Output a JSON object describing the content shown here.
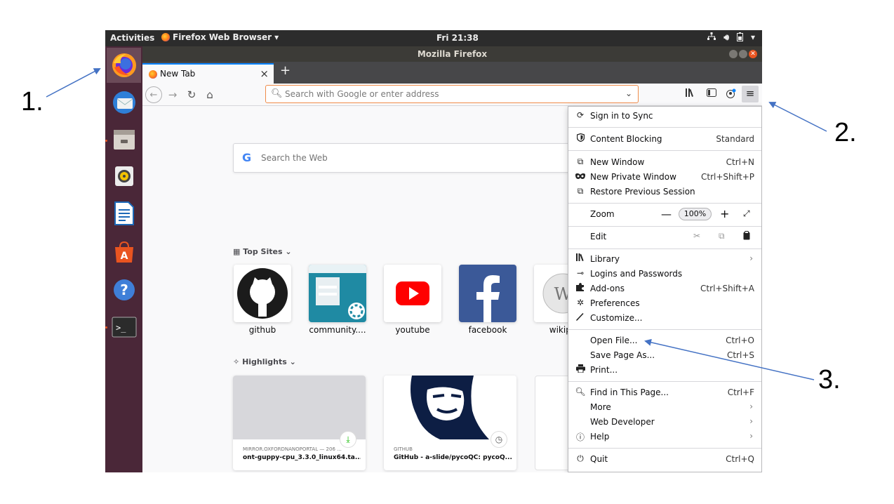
{
  "annotations": {
    "step1": "1.",
    "step2": "2.",
    "step3": "3.",
    "arrow_color": "#4472c4"
  },
  "top_panel": {
    "activities": "Activities",
    "app_menu": "Firefox Web Browser",
    "clock": "Fri 21:38",
    "tray_icons": [
      "network-icon",
      "volume-icon",
      "battery-icon",
      "power-menu-icon"
    ]
  },
  "launcher": {
    "background": "#4a2738",
    "apps": [
      "firefox-icon",
      "thunderbird-icon",
      "files-icon",
      "rhythmbox-icon",
      "libreoffice-writer-icon",
      "ubuntu-software-icon",
      "help-icon",
      "terminal-icon"
    ]
  },
  "window": {
    "title": "Mozilla Firefox"
  },
  "tab": {
    "label": "New Tab"
  },
  "urlbar": {
    "placeholder": "Search with Google or enter address"
  },
  "newtab": {
    "search_placeholder": "Search the Web",
    "top_sites_heading": "Top Sites",
    "top_sites": [
      {
        "label": "github"
      },
      {
        "label": "community...."
      },
      {
        "label": "youtube"
      },
      {
        "label": "facebook"
      },
      {
        "label": "wikipe"
      }
    ],
    "highlights_heading": "Highlights",
    "highlights": [
      {
        "source": "MIRROR.OXFORDNANOPORTAL — 206 ...",
        "title": "ont-guppy-cpu_3.3.0_linux64.ta..."
      },
      {
        "source": "GITHUB",
        "title": "GitHub - a-slide/pycoQC: pycoQ..."
      }
    ]
  },
  "menu": {
    "sign_in": "Sign in to Sync",
    "content_blocking": {
      "label": "Content Blocking",
      "value": "Standard"
    },
    "new_window": {
      "label": "New Window",
      "shortcut": "Ctrl+N"
    },
    "new_private_window": {
      "label": "New Private Window",
      "shortcut": "Ctrl+Shift+P"
    },
    "restore_session": "Restore Previous Session",
    "zoom": {
      "label": "Zoom",
      "minus": "—",
      "value": "100%",
      "plus": "+"
    },
    "edit": {
      "label": "Edit"
    },
    "library": "Library",
    "logins": "Logins and Passwords",
    "addons": {
      "label": "Add-ons",
      "shortcut": "Ctrl+Shift+A"
    },
    "preferences": "Preferences",
    "customize": "Customize...",
    "open_file": {
      "label": "Open File...",
      "shortcut": "Ctrl+O"
    },
    "save_page": {
      "label": "Save Page As...",
      "shortcut": "Ctrl+S"
    },
    "print": "Print...",
    "find": {
      "label": "Find in This Page...",
      "shortcut": "Ctrl+F"
    },
    "more": "More",
    "web_developer": "Web Developer",
    "help": "Help",
    "quit": {
      "label": "Quit",
      "shortcut": "Ctrl+Q"
    }
  }
}
